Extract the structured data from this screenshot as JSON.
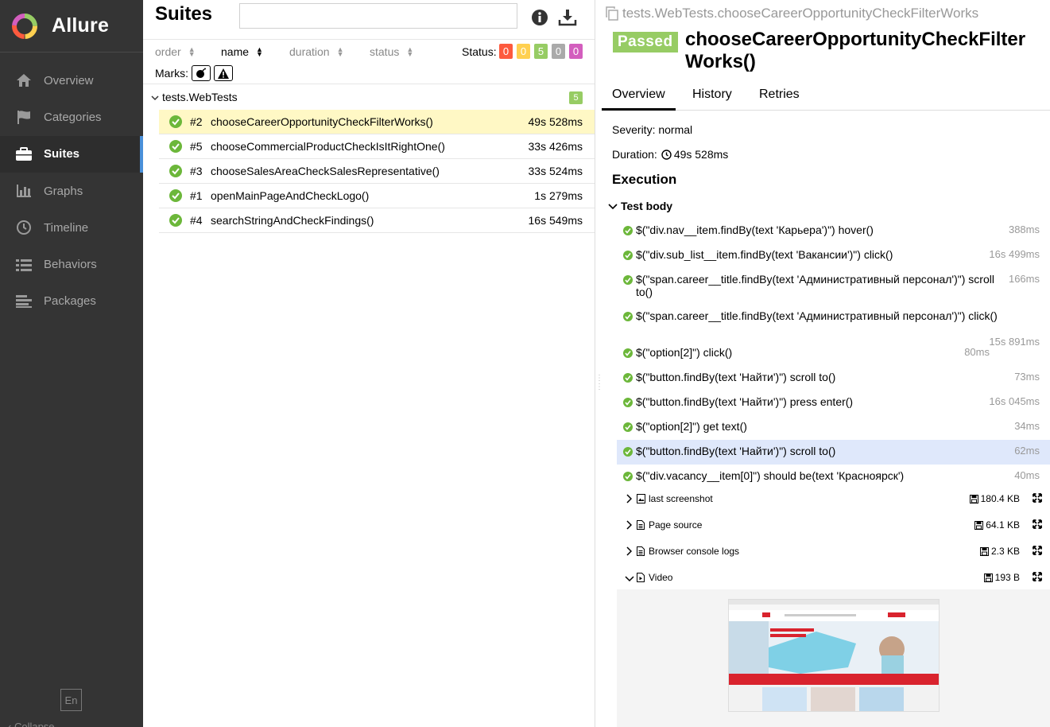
{
  "app": {
    "brand": "Allure"
  },
  "sidebar": {
    "items": [
      {
        "label": "Overview",
        "icon": "home-icon"
      },
      {
        "label": "Categories",
        "icon": "flag-icon"
      },
      {
        "label": "Suites",
        "icon": "briefcase-icon"
      },
      {
        "label": "Graphs",
        "icon": "bar-chart-icon"
      },
      {
        "label": "Timeline",
        "icon": "clock-icon"
      },
      {
        "label": "Behaviors",
        "icon": "list-icon"
      },
      {
        "label": "Packages",
        "icon": "align-left-icon"
      }
    ],
    "active": "Suites",
    "language": "En",
    "collapse_label": "Collapse"
  },
  "suites": {
    "title": "Suites",
    "search": {
      "value": "",
      "placeholder": ""
    },
    "sort": {
      "order": "order",
      "name": "name",
      "duration": "duration",
      "status": "status"
    },
    "status_label": "Status:",
    "status_counts": [
      {
        "value": "0",
        "color": "#fd5a3e"
      },
      {
        "value": "0",
        "color": "#ffd050"
      },
      {
        "value": "5",
        "color": "#97cc64"
      },
      {
        "value": "0",
        "color": "#aaaaaa"
      },
      {
        "value": "0",
        "color": "#d35ebe"
      }
    ],
    "marks_label": "Marks:",
    "group": {
      "name": "tests.WebTests",
      "count": "5"
    },
    "tests": [
      {
        "num": "#2",
        "name": "chooseCareerOpportunityCheckFilterWorks()",
        "duration": "49s 528ms",
        "selected": true
      },
      {
        "num": "#5",
        "name": "chooseCommercialProductCheckIsItRightOne()",
        "duration": "33s 426ms"
      },
      {
        "num": "#3",
        "name": "chooseSalesAreaCheckSalesRepresentative()",
        "duration": "33s 524ms"
      },
      {
        "num": "#1",
        "name": "openMainPageAndCheckLogo()",
        "duration": "1s 279ms"
      },
      {
        "num": "#4",
        "name": "searchStringAndCheckFindings()",
        "duration": "16s 549ms"
      }
    ]
  },
  "detail": {
    "breadcrumb": "tests.WebTests.chooseCareerOpportunityCheckFilterWorks",
    "status": "Passed",
    "title": "chooseCareerOpportunityCheckFilterWorks()",
    "tabs": [
      "Overview",
      "History",
      "Retries"
    ],
    "severity": "Severity: normal",
    "duration_label": "Duration:",
    "duration": "49s 528ms",
    "execution_title": "Execution",
    "test_body_title": "Test body",
    "steps": [
      {
        "text": "$(\"div.nav__item.findBy(text 'Карьера')\") hover()",
        "duration": "388ms"
      },
      {
        "text": "$(\"div.sub_list__item.findBy(text 'Вакансии')\") click()",
        "duration": "16s 499ms"
      },
      {
        "text": "$(\"span.career__title.findBy(text 'Административный персонал')\") scroll to()",
        "duration": "166ms"
      },
      {
        "text": "$(\"span.career__title.findBy(text 'Административный персонал')\") click()",
        "duration": "15s 891ms"
      },
      {
        "text": "$(\"option[2]\") click()",
        "duration": "80ms"
      },
      {
        "text": "$(\"button.findBy(text 'Найти')\") scroll to()",
        "duration": "73ms"
      },
      {
        "text": "$(\"button.findBy(text 'Найти')\") press enter()",
        "duration": "16s 045ms"
      },
      {
        "text": "$(\"option[2]\") get text()",
        "duration": "34ms"
      },
      {
        "text": "$(\"button.findBy(text 'Найти')\") scroll to()",
        "duration": "62ms",
        "highlighted": true
      },
      {
        "text": "$(\"div.vacancy__item[0]\") should be(text 'Красноярск')",
        "duration": "40ms"
      }
    ],
    "attachments": [
      {
        "name": "last screenshot",
        "size": "180.4 KB",
        "icon": "image-icon"
      },
      {
        "name": "Page source",
        "size": "64.1 KB",
        "icon": "file-icon"
      },
      {
        "name": "Browser console logs",
        "size": "2.3 KB",
        "icon": "file-icon"
      },
      {
        "name": "Video",
        "size": "193 B",
        "icon": "video-file-icon",
        "expanded": true
      }
    ]
  },
  "colors": {
    "sidebar_bg": "#343434",
    "passed": "#97cc64",
    "selected_row": "#fff8c5",
    "highlight_step": "#dfe8fb",
    "accent": "#4a90d9"
  }
}
